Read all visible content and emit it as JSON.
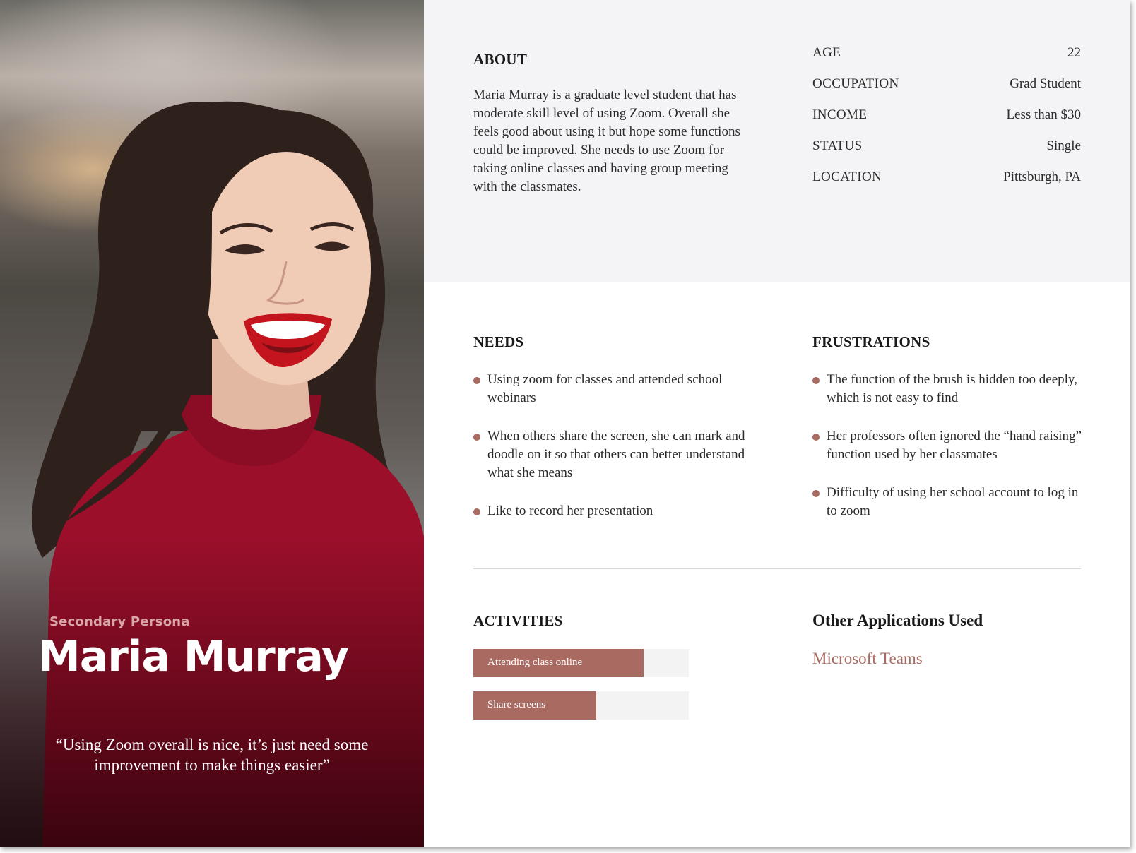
{
  "persona": {
    "label": "Secondary Persona",
    "name": "Maria Murray",
    "quote": "“Using Zoom overall is nice, it’s just need some improvement to make things easier”"
  },
  "about": {
    "heading": "ABOUT",
    "text": "Maria Murray is a graduate level student that has moderate skill level of using Zoom. Overall she feels good about using it but hope some functions could be improved. She needs to use Zoom for taking online classes and having group meeting with the classmates."
  },
  "facts": [
    {
      "label": "AGE",
      "value": "22"
    },
    {
      "label": "OCCUPATION",
      "value": "Grad Student"
    },
    {
      "label": "INCOME",
      "value": "Less than $30"
    },
    {
      "label": "STATUS",
      "value": "Single"
    },
    {
      "label": "LOCATION",
      "value": "Pittsburgh,  PA"
    }
  ],
  "needs": {
    "heading": "NEEDS",
    "items": [
      "Using zoom for classes and attended school webinars",
      "When others share the screen, she can mark and doodle on it so that others can better understand what she means",
      "Like to record her presentation"
    ]
  },
  "frustrations": {
    "heading": "FRUSTRATIONS",
    "items": [
      "The function of the brush is hidden too deeply, which is not easy to find",
      "Her professors often ignored the “hand raising” function used by her classmates",
      "Difficulty of using her school account to log in to zoom"
    ]
  },
  "activities": {
    "heading": "ACTIVITIES",
    "items": [
      {
        "label": "Attending class online",
        "level": 0.79
      },
      {
        "label": "Share screens",
        "level": 0.57
      }
    ]
  },
  "other_apps": {
    "heading": "Other Applications Used",
    "items": [
      "Microsoft Teams"
    ]
  },
  "colors": {
    "accent": "#a96a62",
    "about_background": "#f4f4f6",
    "sweater": "#9b0f2b"
  }
}
